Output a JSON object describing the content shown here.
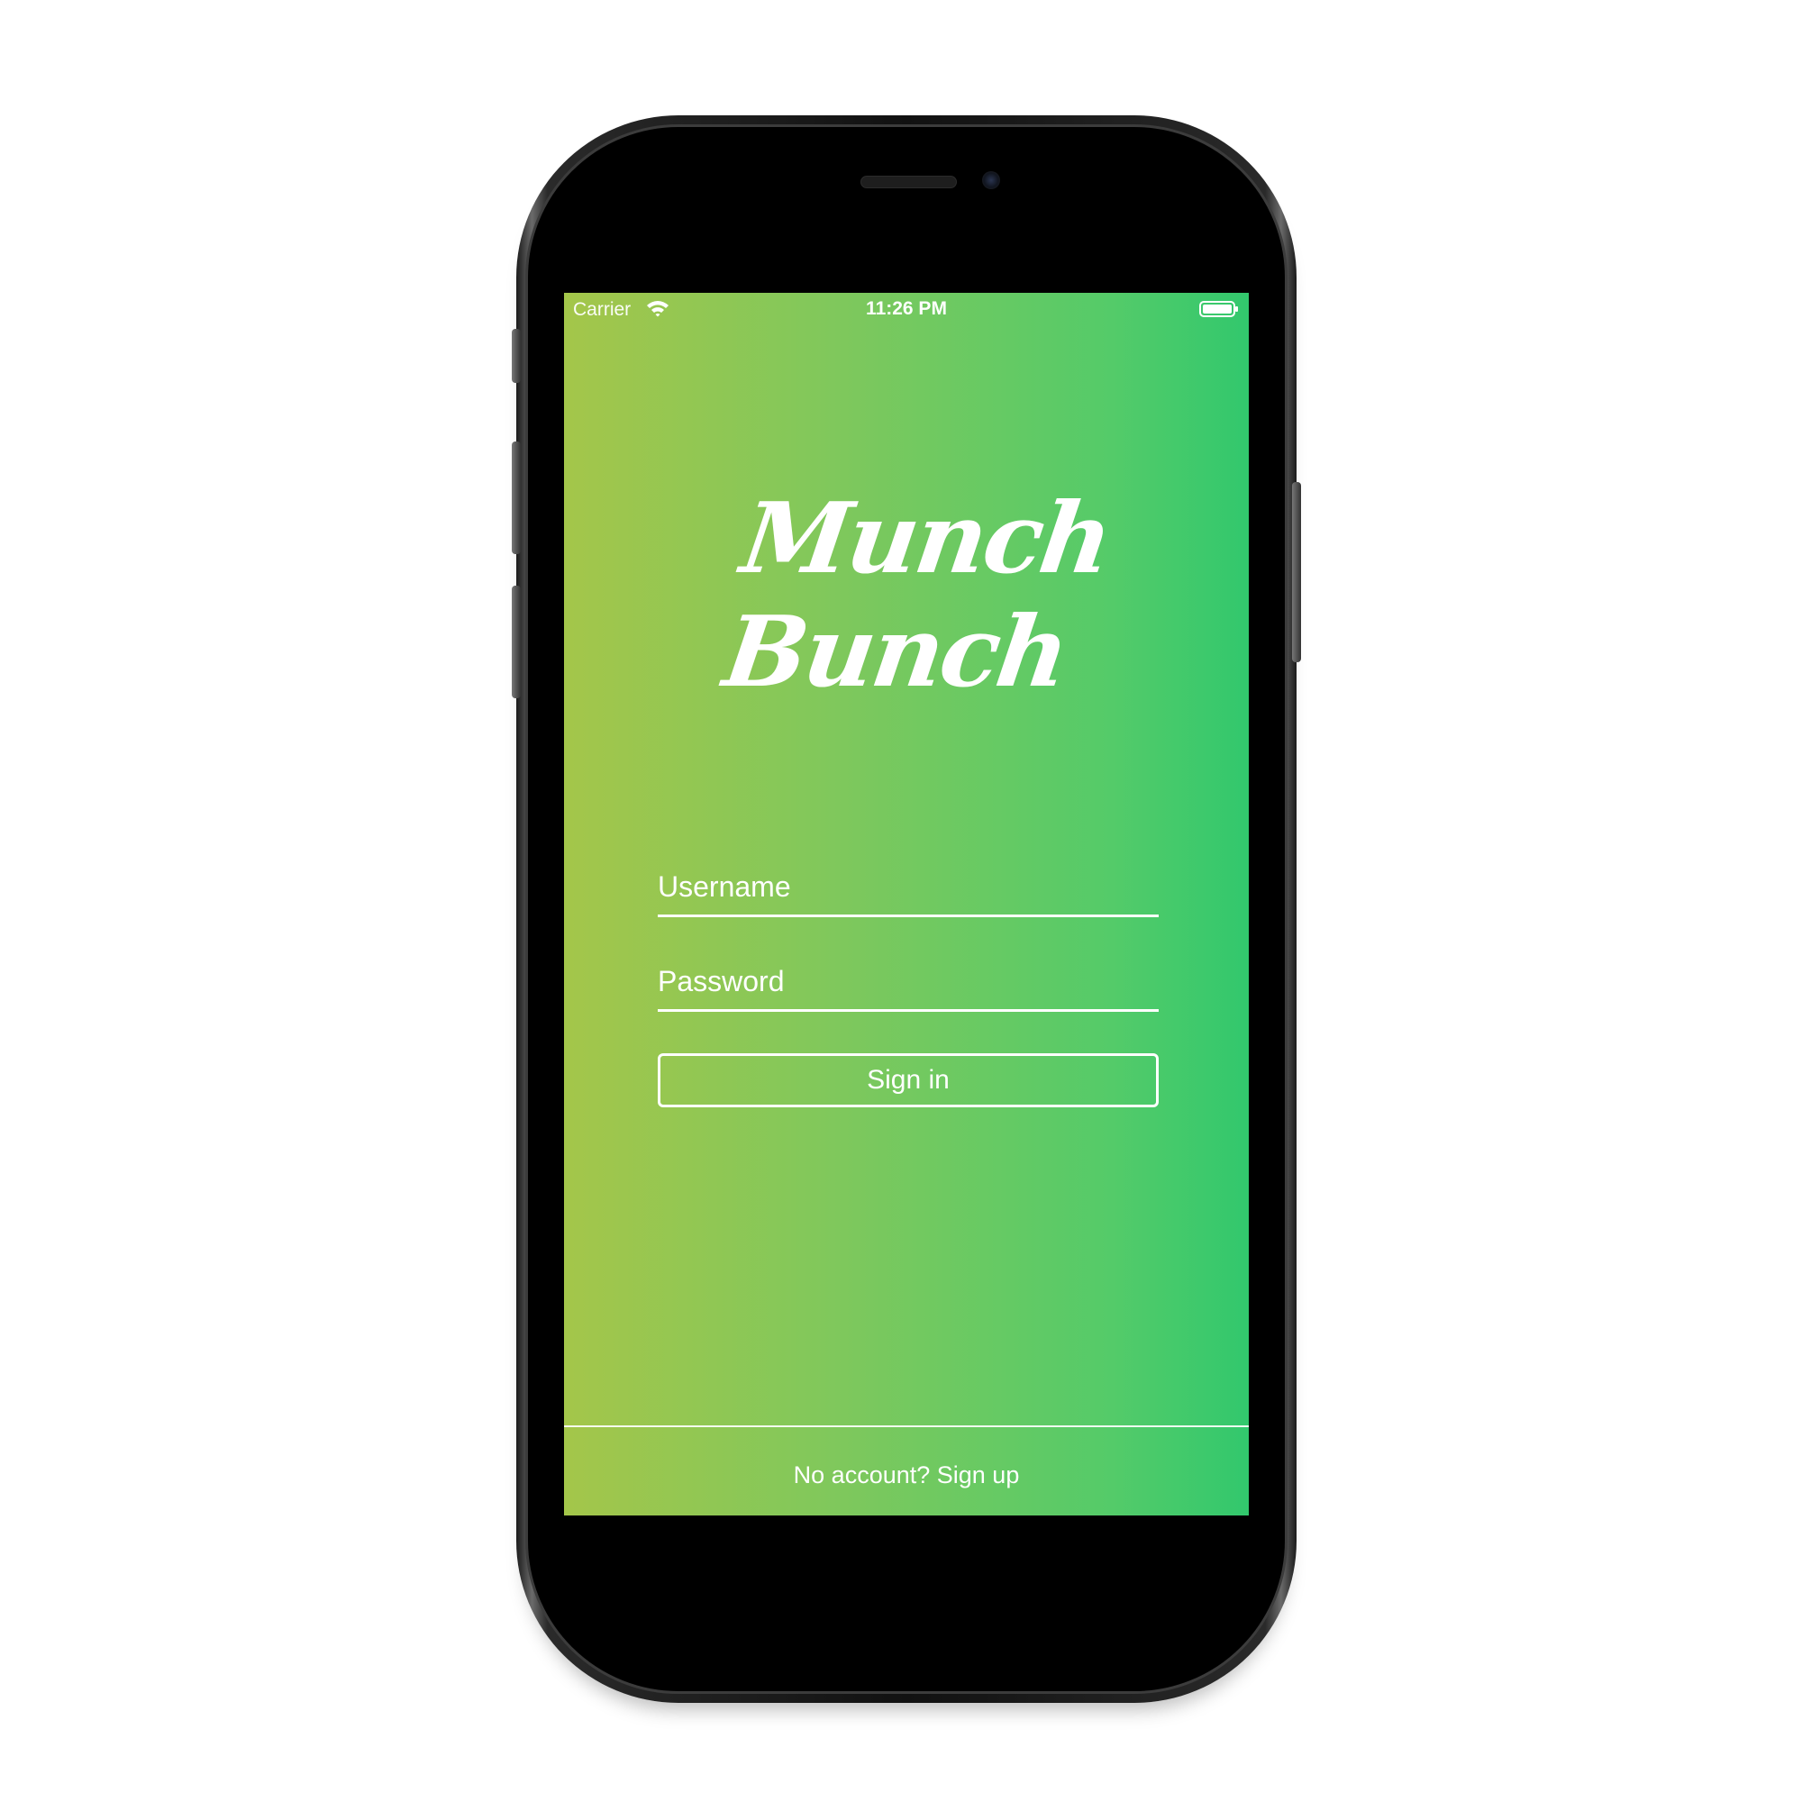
{
  "status_bar": {
    "carrier": "Carrier",
    "time": "11:26 PM",
    "wifi_icon": "wifi-icon",
    "battery_icon": "battery-icon"
  },
  "logo": {
    "line1": "Munch",
    "line2": "Bunch"
  },
  "login_form": {
    "username_placeholder": "Username",
    "username_value": "",
    "password_placeholder": "Password",
    "password_value": "",
    "signin_label": "Sign in"
  },
  "footer": {
    "signup_text": "No account? Sign up"
  },
  "colors": {
    "gradient_left": "#a4c64a",
    "gradient_right": "#32c86d",
    "text": "#ffffff",
    "device_frame": "#111111"
  }
}
